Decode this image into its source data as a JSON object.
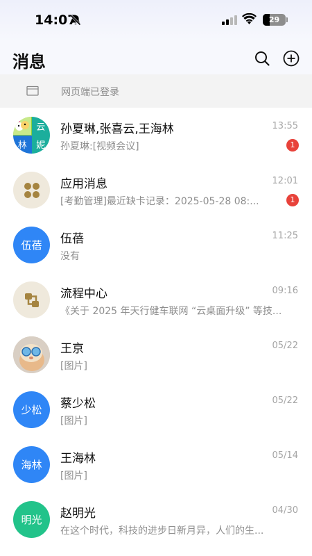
{
  "status_bar": {
    "time": "14:07",
    "battery": "29",
    "icons": [
      "bell-off-icon",
      "signal-icon",
      "wifi-icon",
      "battery-icon"
    ]
  },
  "header": {
    "title": "消息",
    "icons": [
      "search-icon",
      "add-icon"
    ]
  },
  "web_banner": {
    "text": "网页端已登录",
    "icon": "computer-icon"
  },
  "colors": {
    "accent_blue": "#2f86f6",
    "accent_green": "#22c38a",
    "badge_red": "#e8423a"
  },
  "chats": [
    {
      "name": "孙夏琳,张喜云,王海林",
      "time": "13:55",
      "preview": "孙夏琳:[视频会议]",
      "badge": "1",
      "avatar_grid": [
        "",
        "云",
        "林",
        "妮"
      ]
    },
    {
      "name": "应用消息",
      "time": "12:01",
      "preview": "[考勤管理]最近缺卡记录：2025-05-28 08:...",
      "badge": "1",
      "avatar_icon": "apps-icon"
    },
    {
      "name": "伍蓓",
      "time": "11:25",
      "preview": "没有",
      "avatar_text": "伍蓓"
    },
    {
      "name": "流程中心",
      "time": "09:16",
      "preview": "《关于 2025 年天行健车联网 “云桌面升级” 等技...",
      "avatar_icon": "workflow-icon"
    },
    {
      "name": "王京",
      "time": "05/22",
      "preview": "[图片]",
      "avatar_icon": "photo-avatar"
    },
    {
      "name": "蔡少松",
      "time": "05/22",
      "preview": "[图片]",
      "avatar_text": "少松"
    },
    {
      "name": "王海林",
      "time": "05/14",
      "preview": "[图片]",
      "avatar_text": "海林"
    },
    {
      "name": "赵明光",
      "time": "04/30",
      "preview": "在这个时代，科技的进步日新月异，人们的生...",
      "avatar_text": "明光"
    }
  ]
}
